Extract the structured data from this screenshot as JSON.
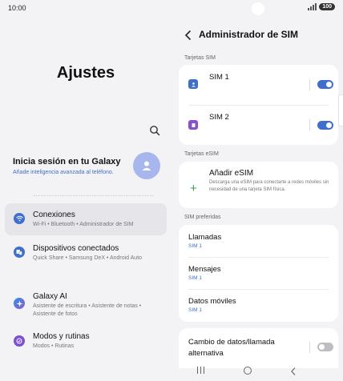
{
  "status": {
    "time": "10:00",
    "battery": "100"
  },
  "left": {
    "title": "Ajustes",
    "account": {
      "title": "Inicia sesión en tu Galaxy",
      "subtitle": "Añade inteligencia avanzada al teléfono."
    },
    "items": [
      {
        "label": "Conexiones",
        "sub": "Wi-Fi  •  Bluetooth  •  Administrador de SIM",
        "icon": "wifi-icon",
        "color": "#3e6fd0",
        "active": true
      },
      {
        "label": "Dispositivos conectados",
        "sub": "Quick Share  •  Samsung DeX  •  Android Auto",
        "icon": "devices-icon",
        "color": "#3e6fd0"
      },
      {
        "label": "Galaxy AI",
        "sub": "Asistente de escritura  •  Asistente de notas  •  Asistente de fotos",
        "icon": "galaxy-ai-icon",
        "color": "#3a7bd5"
      },
      {
        "label": "Modos y rutinas",
        "sub": "Modos  •  Rutinas",
        "icon": "modes-icon",
        "color": "#7a4fd6"
      }
    ]
  },
  "right": {
    "title": "Administrador de SIM",
    "sections": {
      "sim": "Tarjetas SIM",
      "esim": "Tarjetas eSIM",
      "preferred": "SIM preferidas"
    },
    "sims": [
      {
        "label": "SIM 1",
        "icon": "sim1-icon",
        "color": "#3e6fd0",
        "enabled": true
      },
      {
        "label": "SIM 2",
        "icon": "sim2-icon",
        "color": "#8a4fd0",
        "enabled": true
      }
    ],
    "esim": {
      "title": "Añadir eSIM",
      "desc": "Descarga una eSIM para conectarte a redes móviles sin necesidad de una tarjeta SIM física."
    },
    "preferred": [
      {
        "label": "Llamadas",
        "value": "SIM 1"
      },
      {
        "label": "Mensajes",
        "value": "SIM 1"
      },
      {
        "label": "Datos móviles",
        "value": "SIM 1"
      }
    ],
    "switch_row": {
      "label": "Cambio de datos/llamada alternativa",
      "enabled": false
    }
  }
}
